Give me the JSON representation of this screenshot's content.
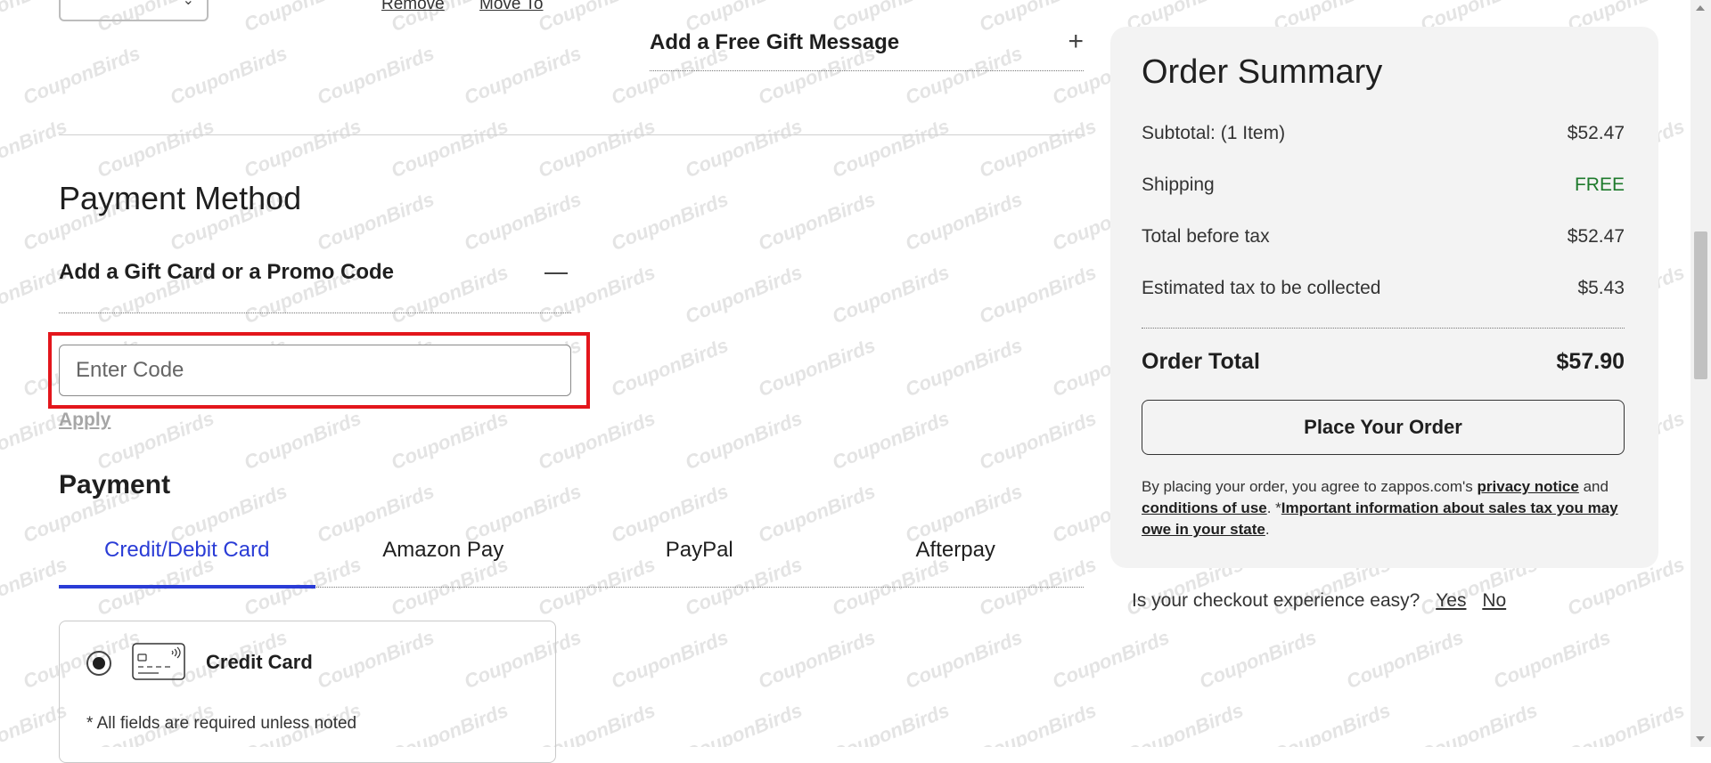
{
  "item": {
    "remove_label": "Remove",
    "move_label": "Move To"
  },
  "gift": {
    "label": "Add a Free Gift Message"
  },
  "payment_method": {
    "title": "Payment Method",
    "promo_label": "Add a Gift Card or a Promo Code",
    "code_placeholder": "Enter Code",
    "apply_label": "Apply"
  },
  "payment": {
    "title": "Payment",
    "tabs": [
      {
        "label": "Credit/Debit Card",
        "active": true
      },
      {
        "label": "Amazon Pay",
        "active": false
      },
      {
        "label": "PayPal",
        "active": false
      },
      {
        "label": "Afterpay",
        "active": false
      }
    ],
    "option_label": "Credit Card",
    "required_note": "* All fields are required unless noted"
  },
  "summary": {
    "title": "Order Summary",
    "rows": [
      {
        "label": "Subtotal: (1 Item)",
        "value": "$52.47"
      },
      {
        "label": "Shipping",
        "value": "FREE"
      },
      {
        "label": "Total before tax",
        "value": "$52.47"
      },
      {
        "label": "Estimated tax to be collected",
        "value": "$5.43"
      }
    ],
    "total_label": "Order Total",
    "total_value": "$57.90",
    "place_order_label": "Place Your Order",
    "legal": {
      "prefix": "By placing your order, you agree to zappos.com's ",
      "privacy_link": "privacy notice",
      "and": " and ",
      "conditions_link": "conditions of use",
      "period1": ". *",
      "tax_link": "Important information about sales tax you may owe in your state",
      "period2": "."
    }
  },
  "feedback": {
    "question": "Is your checkout experience easy?",
    "yes": "Yes",
    "no": "No"
  },
  "watermark_text": "CouponBirds",
  "colors": {
    "accent": "#2a3cd6",
    "free": "#1e7a2c",
    "highlight": "#e3161c"
  }
}
